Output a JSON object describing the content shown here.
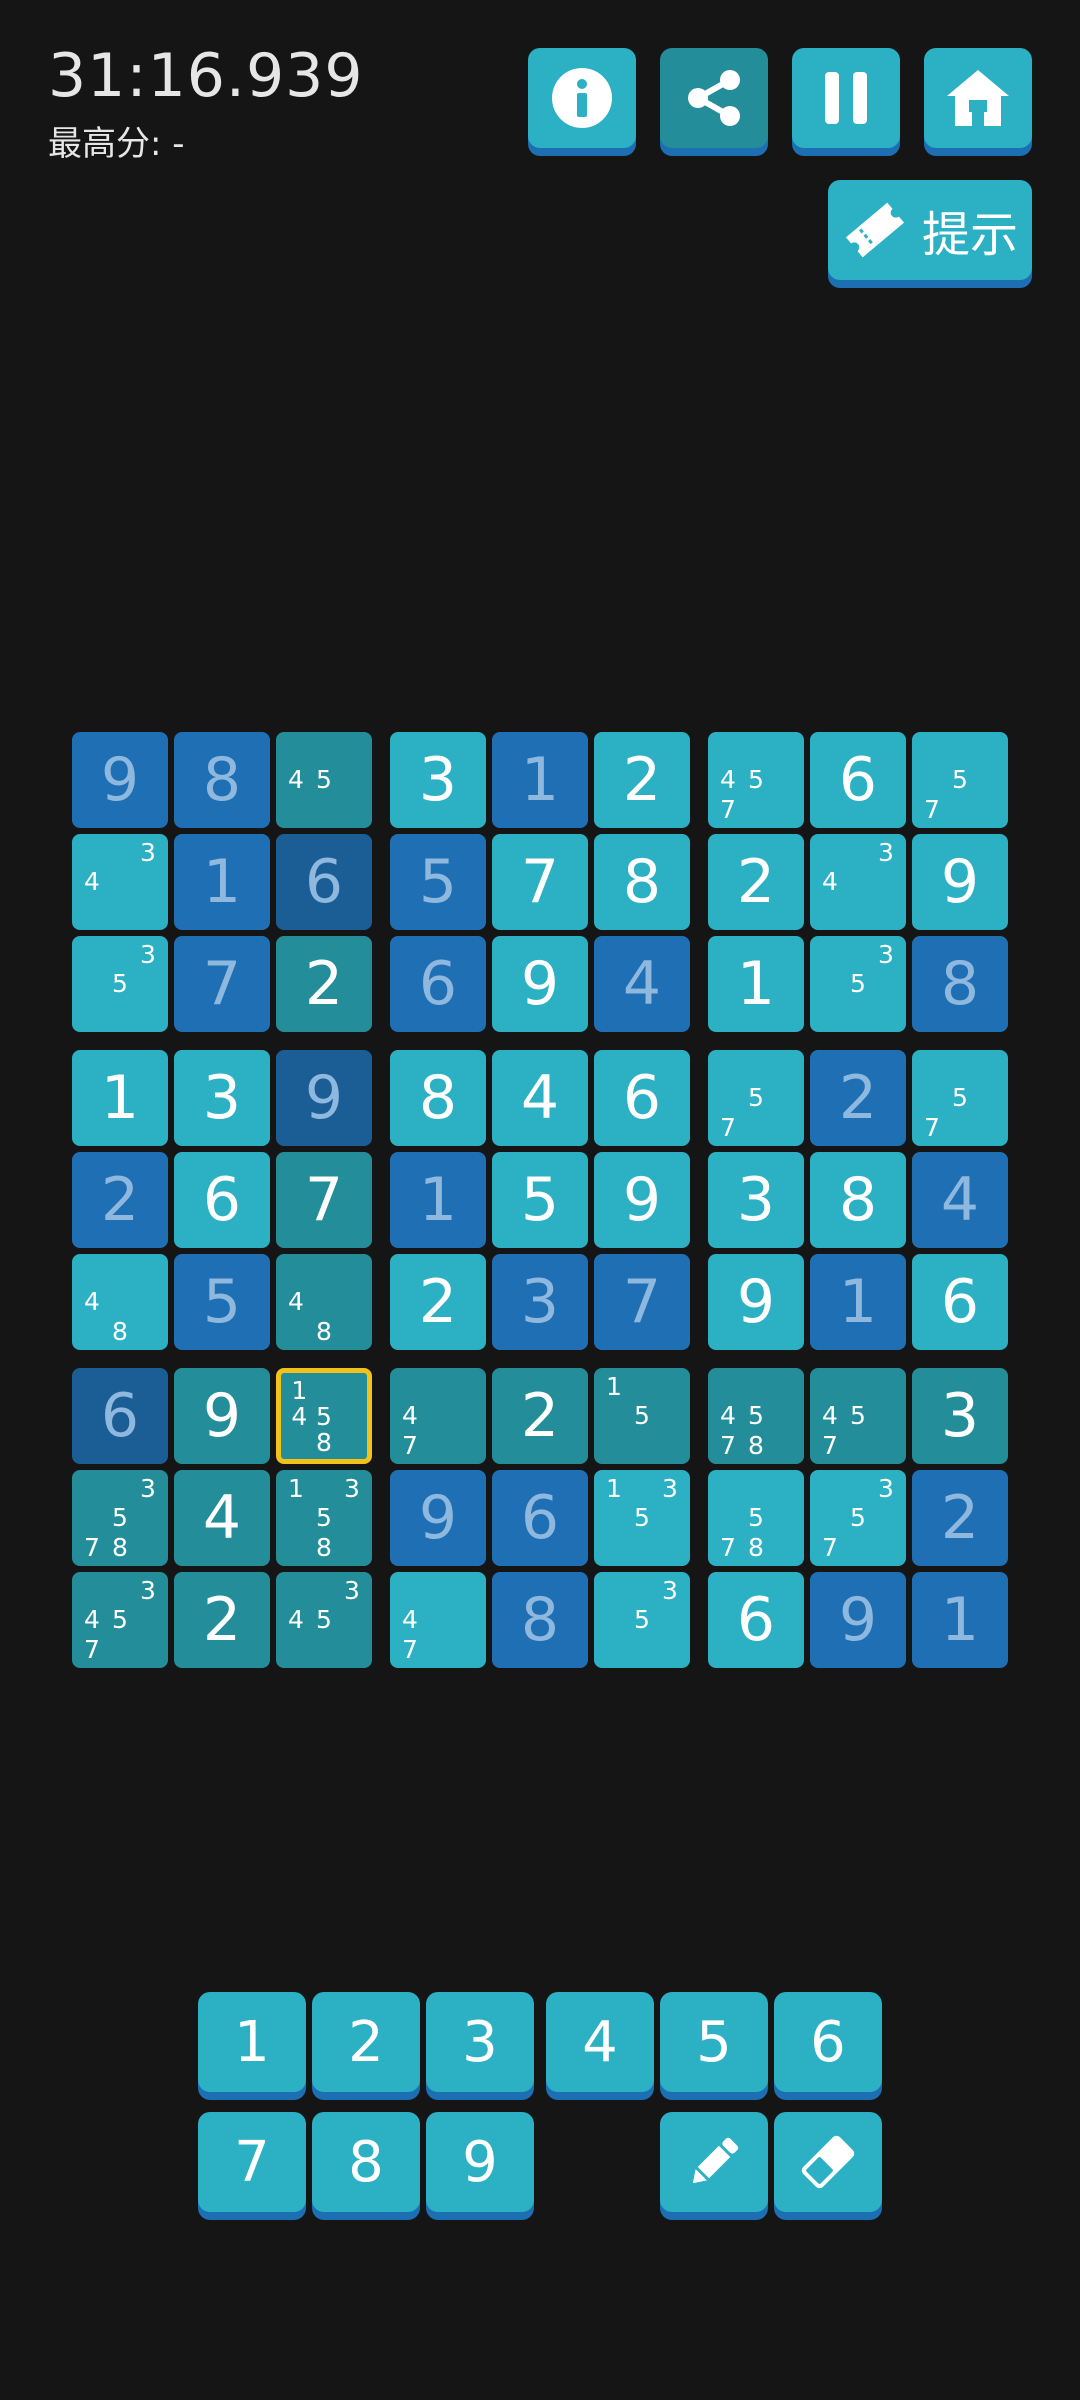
{
  "header": {
    "timer": "31:16.939",
    "best_score": "最高分: -",
    "buttons": [
      "info-icon",
      "share-icon",
      "pause-icon",
      "home-icon"
    ],
    "hint_label": "提示"
  },
  "colors": {
    "background": "#151515",
    "cell_light": "#2cb0c3",
    "cell_blue": "#1f6fb5",
    "cell_dark_blue": "#1b5e96",
    "cell_teal": "#238e9a",
    "selection": "#f2c21b",
    "button": "#2cb0c3",
    "button_shadow": "#1d6fb3"
  },
  "board": {
    "rows": [
      [
        {
          "v": "9",
          "bg": "blue"
        },
        {
          "v": "8",
          "bg": "blue"
        },
        {
          "c": "45",
          "bg": "teal"
        },
        {
          "v": "3",
          "given": true,
          "bg": "light"
        },
        {
          "v": "1",
          "bg": "blue"
        },
        {
          "v": "2",
          "given": true,
          "bg": "light"
        },
        {
          "c": "457",
          "bg": "light"
        },
        {
          "v": "6",
          "given": true,
          "bg": "light"
        },
        {
          "c": "57",
          "bg": "light"
        }
      ],
      [
        {
          "c": "34",
          "bg": "light"
        },
        {
          "v": "1",
          "bg": "blue"
        },
        {
          "v": "6",
          "bg": "darkblue"
        },
        {
          "v": "5",
          "bg": "blue"
        },
        {
          "v": "7",
          "given": true,
          "bg": "light"
        },
        {
          "v": "8",
          "given": true,
          "bg": "light"
        },
        {
          "v": "2",
          "given": true,
          "bg": "light"
        },
        {
          "c": "34",
          "bg": "light"
        },
        {
          "v": "9",
          "given": true,
          "bg": "light"
        }
      ],
      [
        {
          "c": "35",
          "bg": "light"
        },
        {
          "v": "7",
          "bg": "blue"
        },
        {
          "v": "2",
          "given": true,
          "bg": "teal"
        },
        {
          "v": "6",
          "bg": "blue"
        },
        {
          "v": "9",
          "given": true,
          "bg": "light"
        },
        {
          "v": "4",
          "bg": "blue"
        },
        {
          "v": "1",
          "given": true,
          "bg": "light"
        },
        {
          "c": "35",
          "bg": "light"
        },
        {
          "v": "8",
          "bg": "blue"
        }
      ],
      [
        {
          "v": "1",
          "given": true,
          "bg": "light"
        },
        {
          "v": "3",
          "given": true,
          "bg": "light"
        },
        {
          "v": "9",
          "bg": "darkblue"
        },
        {
          "v": "8",
          "given": true,
          "bg": "light"
        },
        {
          "v": "4",
          "given": true,
          "bg": "light"
        },
        {
          "v": "6",
          "given": true,
          "bg": "light"
        },
        {
          "c": "57",
          "bg": "light"
        },
        {
          "v": "2",
          "bg": "blue"
        },
        {
          "c": "57",
          "bg": "light"
        }
      ],
      [
        {
          "v": "2",
          "bg": "blue"
        },
        {
          "v": "6",
          "given": true,
          "bg": "light"
        },
        {
          "v": "7",
          "given": true,
          "bg": "teal"
        },
        {
          "v": "1",
          "bg": "blue"
        },
        {
          "v": "5",
          "given": true,
          "bg": "light"
        },
        {
          "v": "9",
          "given": true,
          "bg": "light"
        },
        {
          "v": "3",
          "given": true,
          "bg": "light"
        },
        {
          "v": "8",
          "given": true,
          "bg": "light"
        },
        {
          "v": "4",
          "bg": "blue"
        }
      ],
      [
        {
          "c": "48",
          "bg": "light"
        },
        {
          "v": "5",
          "bg": "blue"
        },
        {
          "c": "48",
          "bg": "teal"
        },
        {
          "v": "2",
          "given": true,
          "bg": "light"
        },
        {
          "v": "3",
          "bg": "blue"
        },
        {
          "v": "7",
          "bg": "blue"
        },
        {
          "v": "9",
          "given": true,
          "bg": "light"
        },
        {
          "v": "1",
          "bg": "blue"
        },
        {
          "v": "6",
          "given": true,
          "bg": "light"
        }
      ],
      [
        {
          "v": "6",
          "bg": "darkblue"
        },
        {
          "v": "9",
          "given": true,
          "bg": "teal"
        },
        {
          "c": "1458",
          "bg": "teal",
          "selected": true
        },
        {
          "c": "47",
          "bg": "teal"
        },
        {
          "v": "2",
          "given": true,
          "bg": "teal"
        },
        {
          "c": "15",
          "bg": "teal"
        },
        {
          "c": "4578",
          "bg": "teal"
        },
        {
          "c": "457",
          "bg": "teal"
        },
        {
          "v": "3",
          "given": true,
          "bg": "teal"
        }
      ],
      [
        {
          "c": "3578",
          "bg": "teal"
        },
        {
          "v": "4",
          "given": true,
          "bg": "teal"
        },
        {
          "c": "1358",
          "bg": "teal"
        },
        {
          "v": "9",
          "bg": "blue"
        },
        {
          "v": "6",
          "bg": "blue"
        },
        {
          "c": "135",
          "bg": "light"
        },
        {
          "c": "578",
          "bg": "light"
        },
        {
          "c": "357",
          "bg": "light"
        },
        {
          "v": "2",
          "bg": "blue"
        }
      ],
      [
        {
          "c": "3457",
          "bg": "teal"
        },
        {
          "v": "2",
          "given": true,
          "bg": "teal"
        },
        {
          "c": "345",
          "bg": "teal"
        },
        {
          "c": "47",
          "bg": "light"
        },
        {
          "v": "8",
          "bg": "blue"
        },
        {
          "c": "35",
          "bg": "light"
        },
        {
          "v": "6",
          "given": true,
          "bg": "light"
        },
        {
          "v": "9",
          "bg": "blue"
        },
        {
          "v": "1",
          "bg": "blue"
        }
      ]
    ]
  },
  "numpad": {
    "row1": [
      "1",
      "2",
      "3",
      "4",
      "5",
      "6"
    ],
    "row2": [
      "7",
      "8",
      "9"
    ],
    "tools": [
      "pencil-icon",
      "eraser-icon"
    ]
  }
}
